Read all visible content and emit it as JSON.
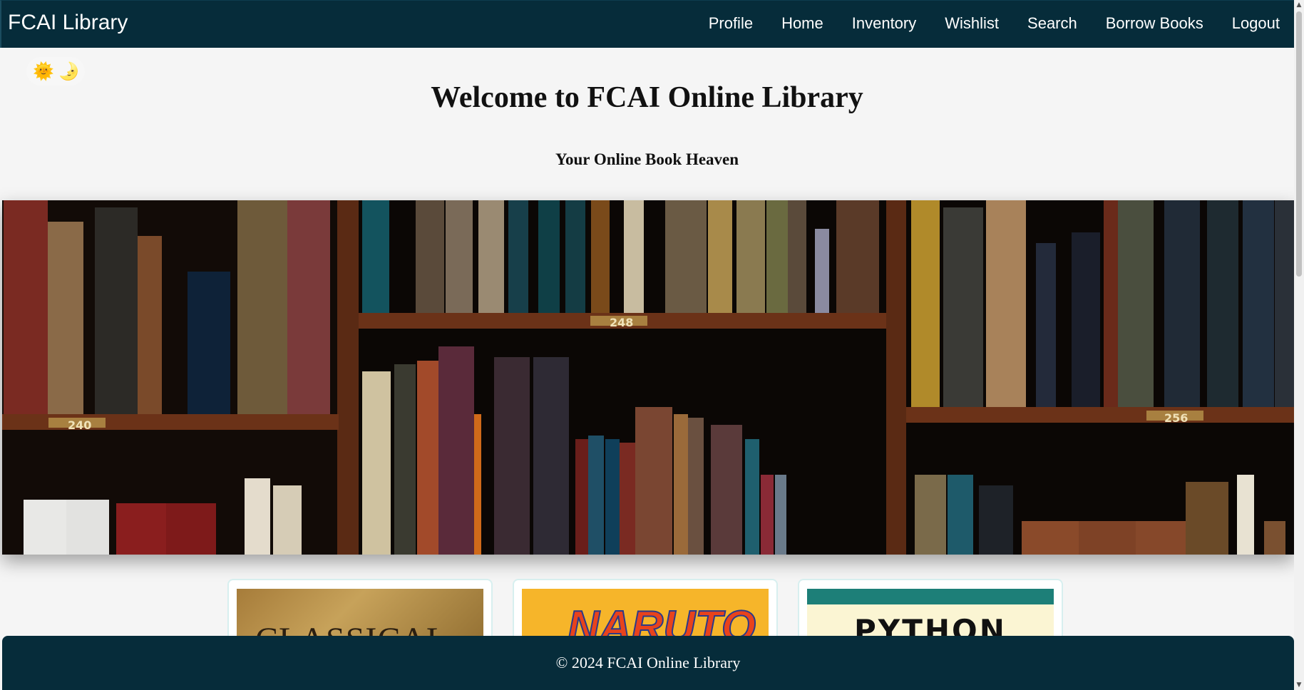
{
  "navbar": {
    "brand": "FCAI Library",
    "links": [
      {
        "label": "Profile"
      },
      {
        "label": "Home"
      },
      {
        "label": "Inventory"
      },
      {
        "label": "Wishlist"
      },
      {
        "label": "Search"
      },
      {
        "label": "Borrow Books"
      },
      {
        "label": "Logout"
      }
    ]
  },
  "theme_toggle": {
    "light_icon": "sun-icon",
    "dark_icon": "moon-icon",
    "light_glyph": "🌞",
    "dark_glyph": "🌛"
  },
  "hero": {
    "title": "Welcome to FCAI Online Library",
    "subtitle": "Your Online Book Heaven"
  },
  "banner": {
    "shelf_labels": [
      "240",
      "248",
      "256"
    ]
  },
  "book_cards": [
    {
      "cover_text": "CLASSICAL",
      "accent": "#a67c3a"
    },
    {
      "cover_text": "NARUTO",
      "accent": "#f6b52a"
    },
    {
      "cover_text": "PYTHON",
      "accent": "#1d7f78"
    }
  ],
  "footer": {
    "text": "© 2024 FCAI Online Library"
  },
  "colors": {
    "navbar_bg": "#062c3a",
    "page_bg": "#f5f5f5",
    "card_border": "#d7efef"
  }
}
